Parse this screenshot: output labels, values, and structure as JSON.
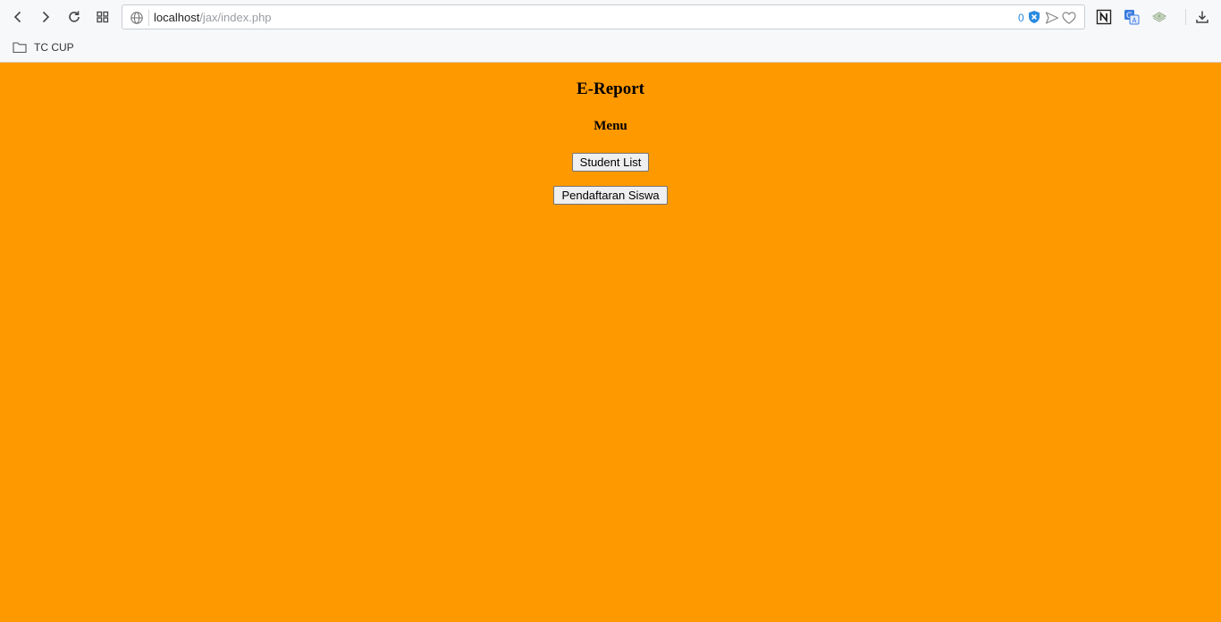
{
  "browser": {
    "url_host": "localhost",
    "url_path": "/jax/index.php",
    "blocked_count": "0",
    "bookmarks": [
      {
        "label": "TC CUP",
        "icon": "folder-icon"
      }
    ]
  },
  "page": {
    "background": "#ff9900",
    "title": "E-Report",
    "subtitle": "Menu",
    "buttons": {
      "student_list": "Student List",
      "pendaftaran": "Pendaftaran Siswa"
    }
  }
}
